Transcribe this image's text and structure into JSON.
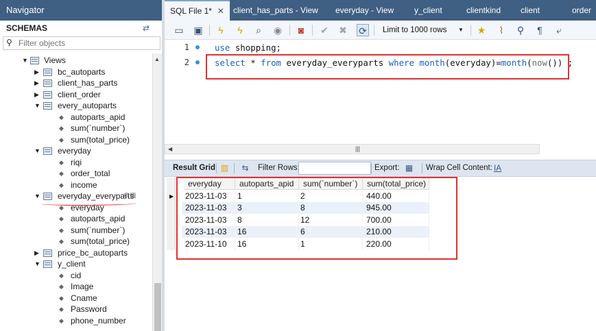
{
  "navigator": {
    "title": "Navigator",
    "schemas_label": "SCHEMAS",
    "filter_placeholder": "Filter objects",
    "tree": {
      "views_label": "Views",
      "bc_autoparts": "bc_autoparts",
      "client_has_parts": "client_has_parts",
      "client_order": "client_order",
      "every_autoparts": "every_autoparts",
      "every_autoparts_cols": [
        "autoparts_apid",
        "sum(`number`)",
        "sum(total_price)"
      ],
      "everyday": "everyday",
      "everyday_cols": [
        "riqi",
        "order_total",
        "income"
      ],
      "everyday_everyparts": "everyday_everyparts",
      "everyday_everyparts_cols": [
        "everyday",
        "autoparts_apid",
        "sum(`number`)",
        "sum(total_price)"
      ],
      "price_bc_autoparts": "price_bc_autoparts",
      "y_client": "y_client",
      "y_client_cols": [
        "cid",
        "Image",
        "Cname",
        "Password",
        "phone_number"
      ]
    }
  },
  "tabs": [
    {
      "label": "SQL File 1*",
      "active": true
    },
    {
      "label": "client_has_parts - View"
    },
    {
      "label": "everyday - View"
    },
    {
      "label": "y_client"
    },
    {
      "label": "clientkind"
    },
    {
      "label": "client"
    },
    {
      "label": "order"
    }
  ],
  "toolbar": {
    "limit_label": "Limit to 1000 rows"
  },
  "editor": {
    "line1_no": "1",
    "line2_no": "2",
    "line1": {
      "kw": "use",
      "rest": " shopping;"
    },
    "line2": {
      "kw_select": "select",
      "star": " * ",
      "kw_from": "from",
      "table": " everyday_everyparts ",
      "kw_where": "where",
      "fn_month1": " month",
      "arg1": "(everyday)=",
      "fn_month2": "month",
      "arg2_open": "(",
      "fn_now": "now",
      "arg2_close": "()) ;"
    }
  },
  "result_toolbar": {
    "result_grid": "Result Grid",
    "filter_rows": "Filter Rows:",
    "export": "Export:",
    "wrap_cell": "Wrap Cell Content:"
  },
  "grid": {
    "headers": [
      "everyday",
      "autoparts_apid",
      "sum(`number`)",
      "sum(total_price)"
    ],
    "rows": [
      [
        "2023-11-03",
        "1",
        "2",
        "440.00"
      ],
      [
        "2023-11-03",
        "3",
        "8",
        "945.00"
      ],
      [
        "2023-11-03",
        "8",
        "12",
        "700.00"
      ],
      [
        "2023-11-03",
        "16",
        "6",
        "210.00"
      ],
      [
        "2023-11-10",
        "16",
        "1",
        "220.00"
      ]
    ]
  },
  "colors": {
    "header_blue": "#3f5f83",
    "highlight_red": "#e03131",
    "keyword_blue": "#1a5fc1"
  }
}
